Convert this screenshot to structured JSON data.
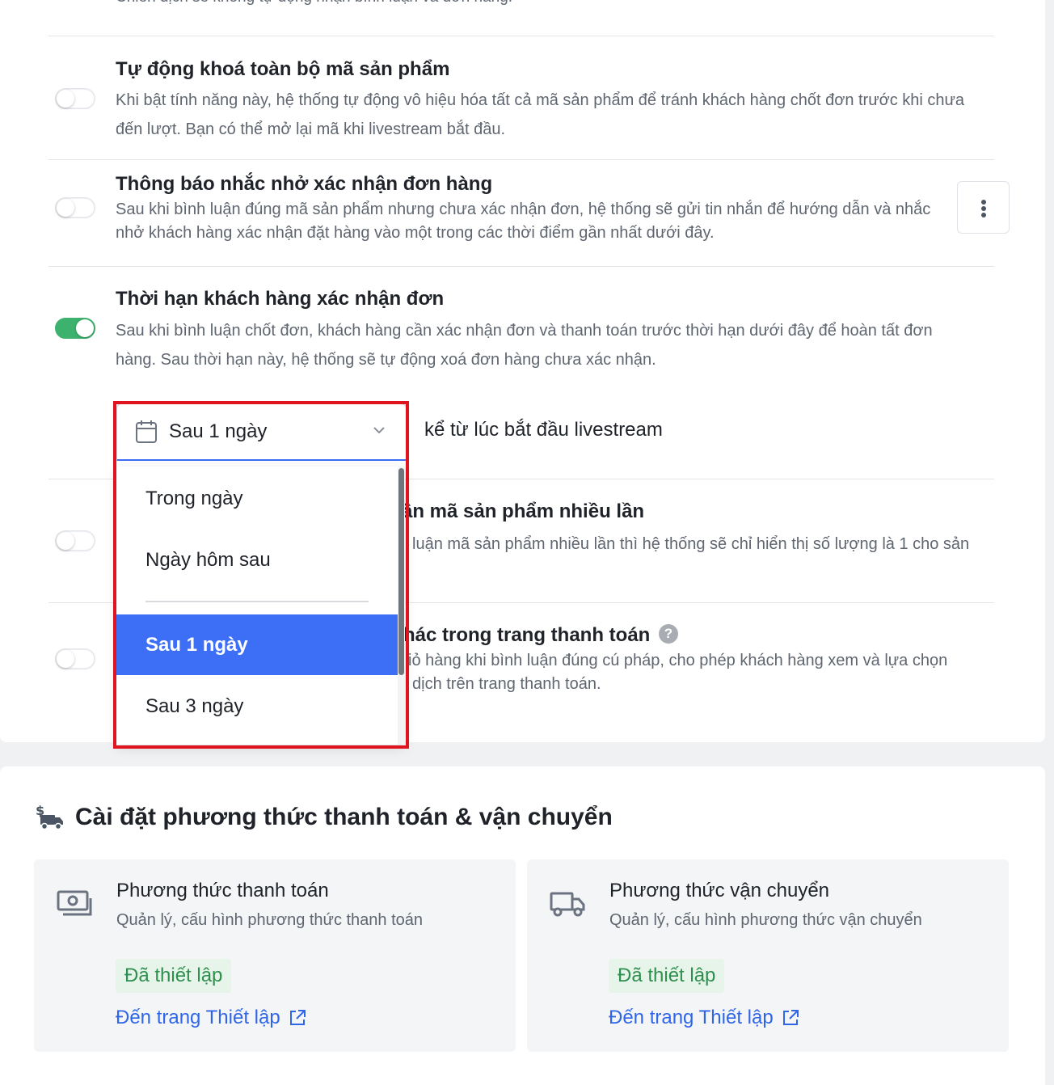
{
  "top_partial_text": "Chiến dịch sẽ không tự động nhận bình luận và đơn hàng.",
  "settings": [
    {
      "title": "Tự động khoá toàn bộ mã sản phẩm",
      "description": "Khi bật tính năng này, hệ thống tự động vô hiệu hóa tất cả mã sản phẩm để tránh khách hàng chốt đơn trước khi chưa đến lượt. Bạn có thể mở lại mã khi livestream bắt đầu.",
      "enabled": false
    },
    {
      "title": "Thông báo nhắc nhở xác nhận đơn hàng",
      "description": "Sau khi bình luận đúng mã sản phẩm nhưng chưa xác nhận đơn, hệ thống sẽ gửi tin nhắn để hướng dẫn và nhắc nhở khách hàng xác nhận đặt hàng vào một trong các thời điểm gần nhất dưới đây.",
      "enabled": false
    },
    {
      "title": "Thời hạn khách hàng xác nhận đơn",
      "description": "Sau khi bình luận chốt đơn, khách hàng cần xác nhận đơn và thanh toán trước thời hạn dưới đây để hoàn tất đơn hàng. Sau thời hạn này, hệ thống sẽ tự động xoá đơn hàng chưa xác nhận.",
      "enabled": true
    },
    {
      "title_partial": "ận mã sản phẩm nhiều lần",
      "description_partial": "luận mã sản phẩm nhiều lần thì hệ thống sẽ chỉ hiển thị số lượng là 1 cho sản",
      "enabled": false
    },
    {
      "title_partial": "hác trong trang thanh toán",
      "description_partial_1": "iỏ hàng khi bình luận đúng cú pháp, cho phép khách hàng xem và lựa chọn",
      "description_partial_2": "dịch trên trang thanh toán.",
      "enabled": false
    }
  ],
  "deadline_select": {
    "value": "Sau 1 ngày",
    "suffix": "kể từ lúc bắt đầu livestream",
    "options": [
      "Trong ngày",
      "Ngày hôm sau",
      "Sau 1 ngày",
      "Sau 3 ngày"
    ],
    "selected_index": 2
  },
  "payment_shipping": {
    "title": "Cài đặt phương thức thanh toán & vận chuyển",
    "cards": [
      {
        "title": "Phương thức thanh toán",
        "description": "Quản lý, cấu hình phương thức thanh toán",
        "status": "Đã thiết lập",
        "link": "Đến trang Thiết lập",
        "icon": "money-icon"
      },
      {
        "title": "Phương thức vận chuyển",
        "description": "Quản lý, cấu hình phương thức vận chuyển",
        "status": "Đã thiết lập",
        "link": "Đến trang Thiết lập",
        "icon": "truck-icon"
      }
    ]
  },
  "colors": {
    "toggle_on": "#3db26e",
    "selected_option": "#3d6ef6",
    "link": "#2f66e8",
    "badge_text": "#2f8f4e",
    "badge_bg": "#e6f4ea",
    "highlight": "#e0141e"
  }
}
